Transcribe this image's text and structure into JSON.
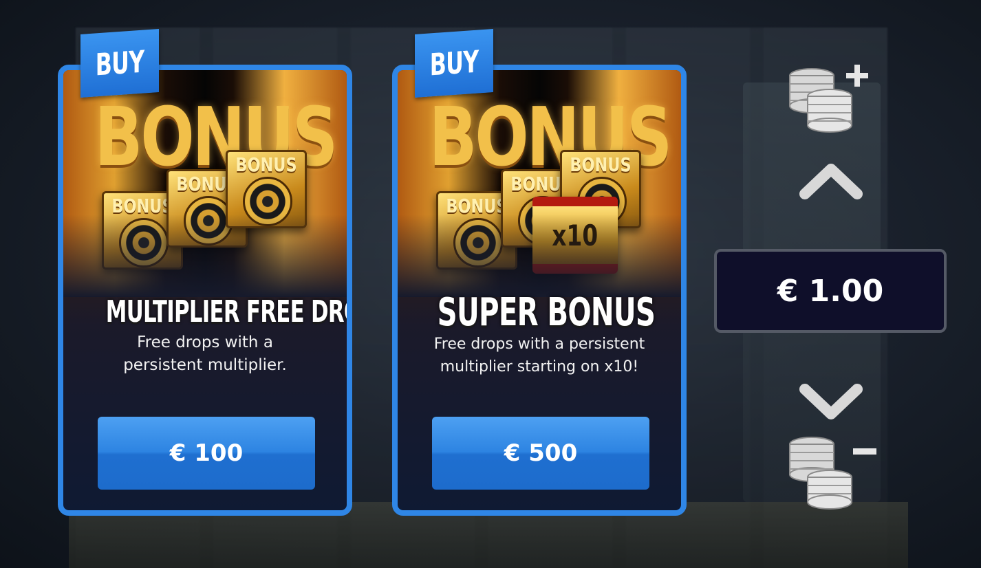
{
  "cards": [
    {
      "flag": "BUY",
      "art_text": "BONUS",
      "tile_labels": [
        "BONUS",
        "BONUS",
        "BONUS"
      ],
      "title": "MULTIPLIER FREE DROPS",
      "description": "Free drops with a persistent multiplier.",
      "price": "€ 100"
    },
    {
      "flag": "BUY",
      "art_text": "BONUS",
      "tile_labels": [
        "BONUS",
        "BONUS",
        "BONUS"
      ],
      "badge": "x10",
      "title": "SUPER BONUS",
      "description": "Free drops with a persistent multiplier starting on x10!",
      "price": "€ 500"
    }
  ],
  "bet": {
    "value": "€ 1.00",
    "increase_icon": "coins-plus-icon",
    "decrease_icon": "coins-minus-icon",
    "up_icon": "chevron-up-icon",
    "down_icon": "chevron-down-icon"
  },
  "colors": {
    "accent": "#2f86e6",
    "button": "#2d84e2",
    "gold": "#f2c04a",
    "bet_box_bg": "#0f0f2a"
  }
}
